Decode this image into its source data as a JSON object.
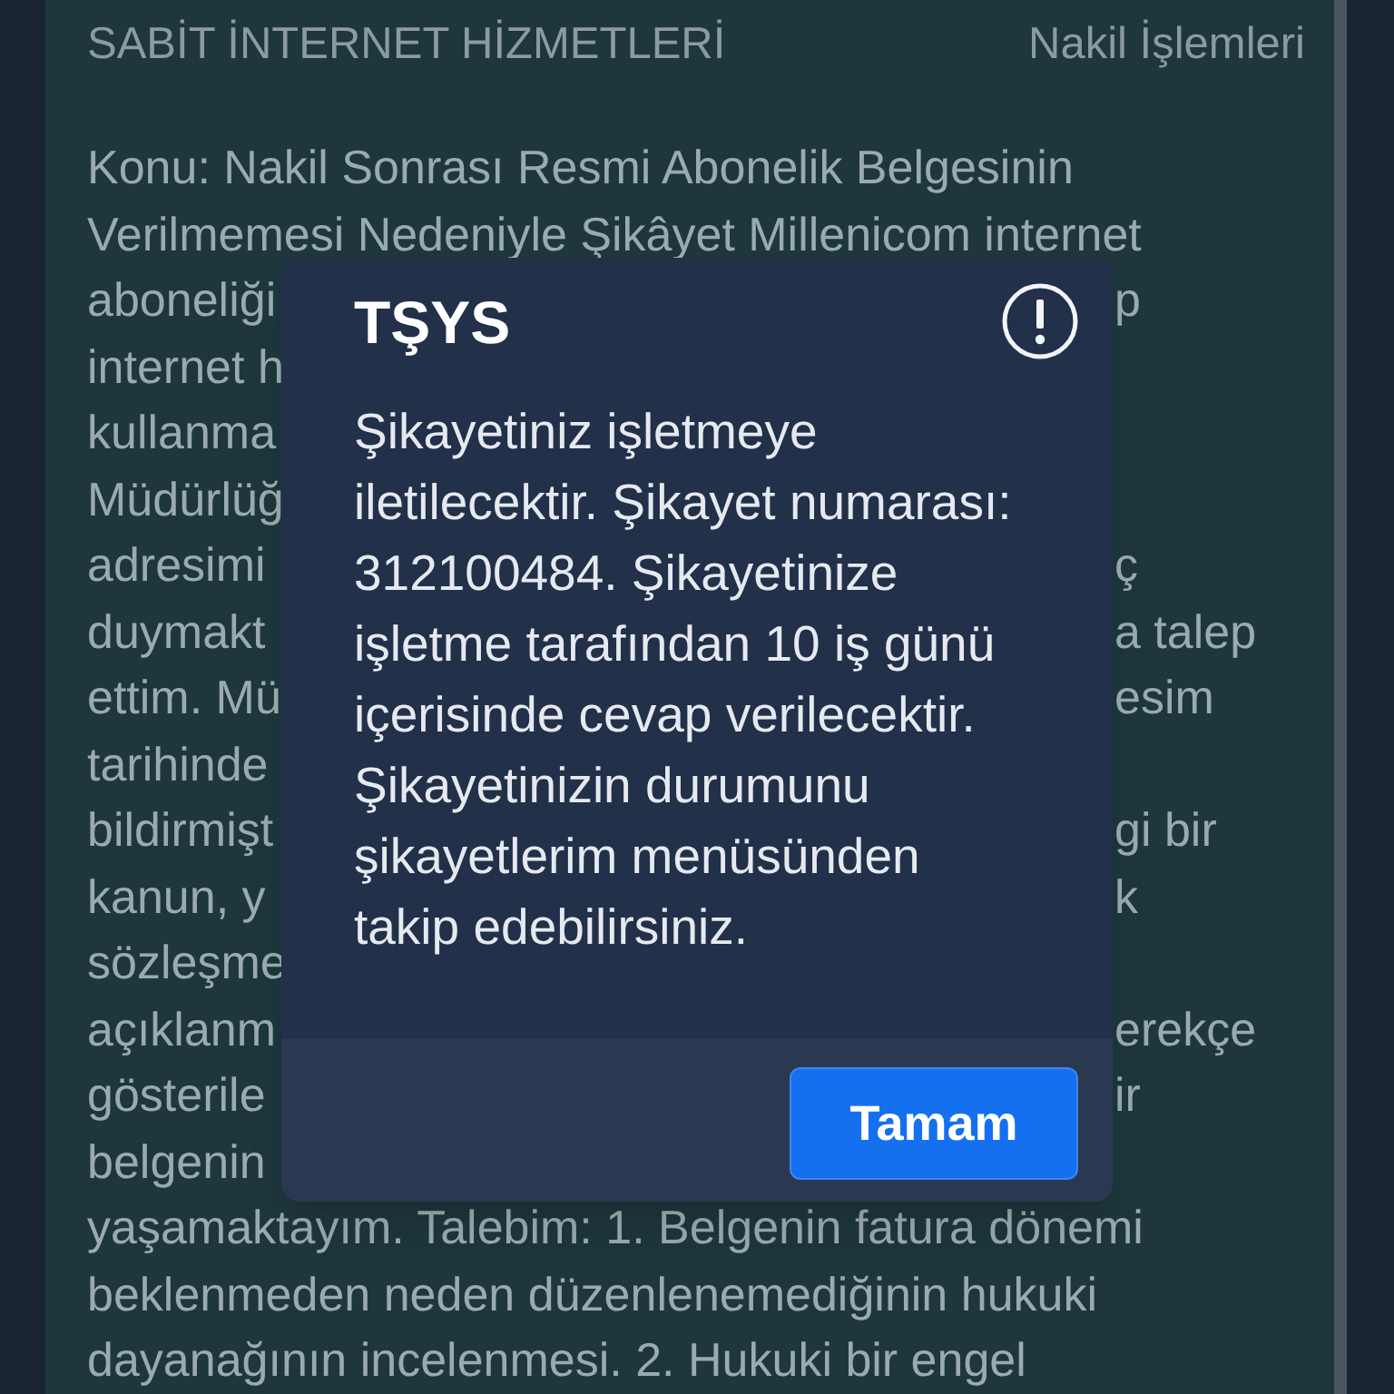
{
  "header": {
    "category": "SABİT İNTERNET HİZMETLERİ",
    "topic": "Nakil İşlemleri"
  },
  "complaint_lines": [
    {
      "left": "Konu: Nakil Sonrası Resmi Abonelik Belgesinin"
    },
    {
      "left": "Verilmemesi Nedeniyle Şikâyet Millenicom internet"
    },
    {
      "left": "aboneliği",
      "right": "p"
    },
    {
      "left": "internet h"
    },
    {
      "left": "kullanma"
    },
    {
      "left": "Müdürlüğ"
    },
    {
      "left": "adresimi",
      "right": "ç"
    },
    {
      "left": "duymakt",
      "right": "a talep"
    },
    {
      "left": "ettim. Mü",
      "right": "esim"
    },
    {
      "left": "tarihinde"
    },
    {
      "left": "bildirmişt",
      "right": "gi bir"
    },
    {
      "left": "kanun, y",
      "right": "k"
    },
    {
      "left": "sözleşme"
    },
    {
      "left": "açıklanm",
      "right": "erekçe"
    },
    {
      "left": "gösterile",
      "right": "ir"
    },
    {
      "left": "belgenin"
    },
    {
      "left": "yaşamaktayım. Talebim: 1. Belgenin fatura dönemi"
    },
    {
      "left": "beklenmeden neden düzenlenemediğinin hukuki"
    },
    {
      "left": "dayanağının incelenmesi. 2. Hukuki bir engel"
    }
  ],
  "dialog": {
    "title": "TŞYS",
    "message": "Şikayetiniz işletmeye iletilecektir. Şikayet numarası: 312100484. Şikayetinize işletme tarafından 10 iş günü içerisinde cevap verilecektir. Şikayetinizin durumunu şikayetlerim menüsünden takip edebilirsiniz.",
    "buttons": [
      {
        "label": "Tamam"
      }
    ]
  }
}
